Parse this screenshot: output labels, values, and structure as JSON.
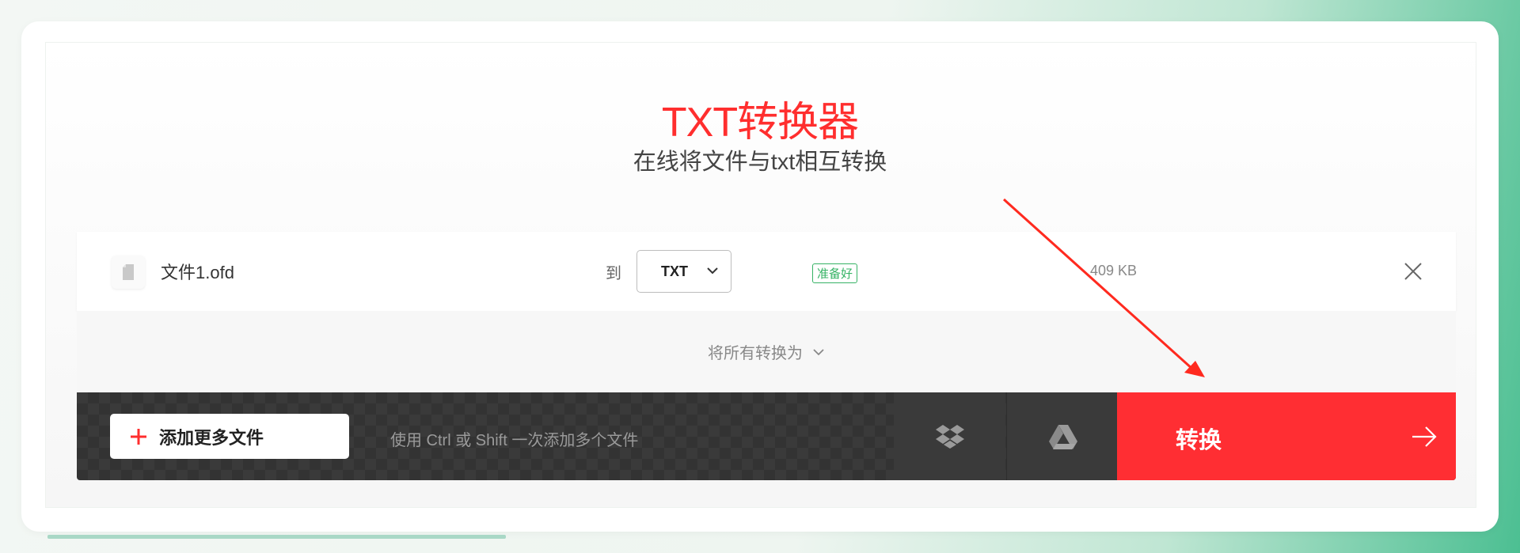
{
  "page": {
    "title": "TXT转换器",
    "subtitle": "在线将文件与txt相互转换"
  },
  "file": {
    "name": "文件1.ofd",
    "to_label": "到",
    "format": "TXT",
    "status": "准备好",
    "size": "409 KB"
  },
  "convert_all": {
    "label": "将所有转换为"
  },
  "toolbar": {
    "add_files_label": "添加更多文件",
    "hint": "使用 Ctrl 或 Shift 一次添加多个文件",
    "convert_label": "转换"
  },
  "colors": {
    "accent": "#ff2e2e",
    "ready_green": "#36b365",
    "bar_dark": "#3a3a3a"
  },
  "icons": [
    "file-icon",
    "chevron-down-icon",
    "close-icon",
    "plus-icon",
    "dropbox-icon",
    "google-drive-icon",
    "arrow-right-icon"
  ]
}
